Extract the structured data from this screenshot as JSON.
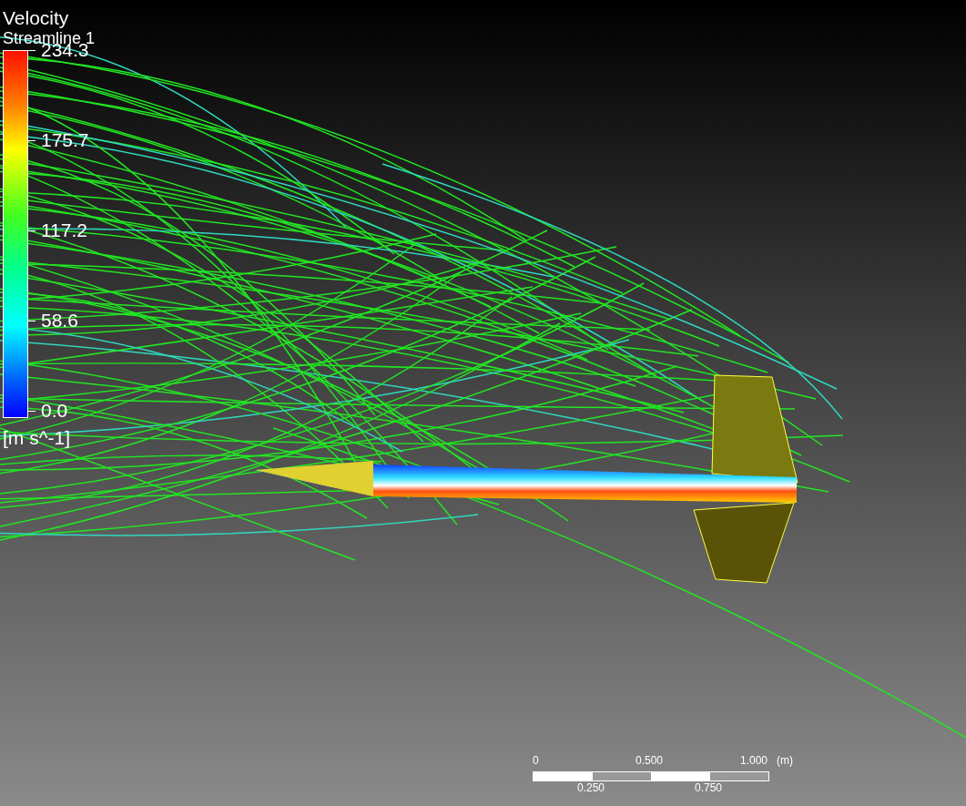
{
  "legend": {
    "title": "Velocity",
    "subtitle": "Streamline 1",
    "labels": [
      "234.3",
      "175.7",
      "117.2",
      "58.6",
      "0.0"
    ],
    "unit": "[m s^-1]"
  },
  "scale_bar": {
    "top_labels": [
      "0",
      "0.500",
      "1.000"
    ],
    "unit": "(m)",
    "bottom_labels": [
      "0.250",
      "0.750"
    ]
  }
}
